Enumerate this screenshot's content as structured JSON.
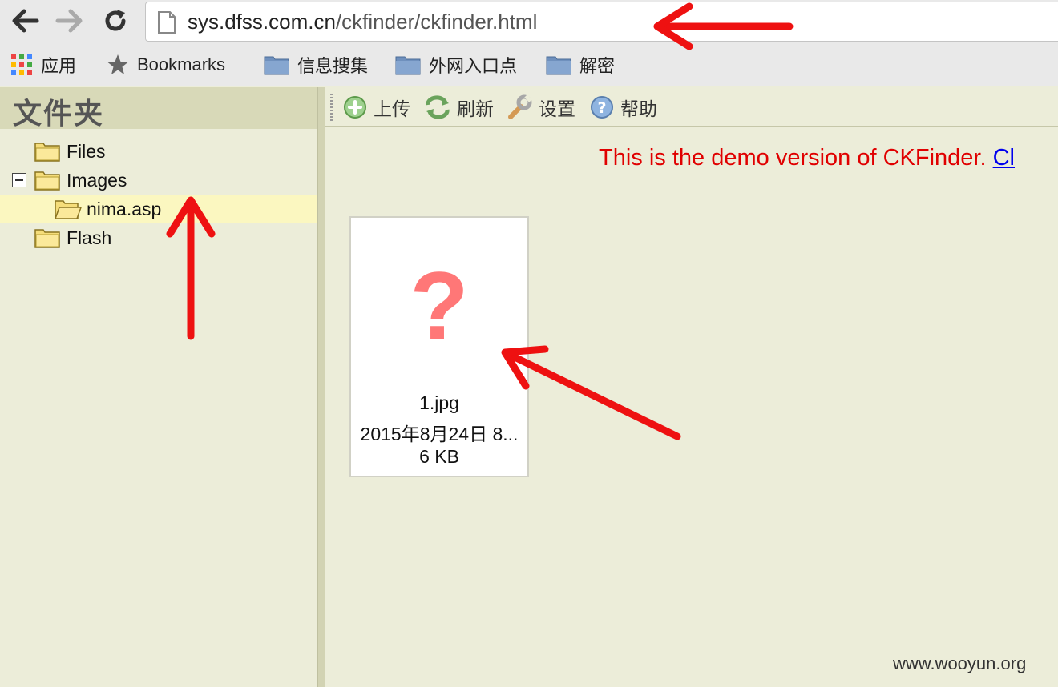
{
  "browser": {
    "url_domain": "sys.dfss.com.cn",
    "url_path": "/ckfinder/ckfinder.html",
    "back_icon": "back-arrow-icon",
    "forward_icon": "forward-arrow-icon",
    "reload_icon": "reload-icon"
  },
  "bookmarks": {
    "apps_label": "应用",
    "bookmarks_label": "Bookmarks",
    "folders": [
      "信息搜集",
      "外网入口点",
      "解密"
    ]
  },
  "left_panel": {
    "title": "文件夹",
    "tree": [
      {
        "label": "Files",
        "level": 0
      },
      {
        "label": "Images",
        "level": 0
      },
      {
        "label": "nima.asp",
        "level": 1,
        "selected": true
      },
      {
        "label": "Flash",
        "level": 0
      }
    ]
  },
  "toolbar": {
    "upload_label": "上传",
    "refresh_label": "刷新",
    "settings_label": "设置",
    "help_label": "帮助"
  },
  "main": {
    "demo_notice": "This is the demo version of CKFinder. ",
    "demo_link": "Cl"
  },
  "file": {
    "name": "1.jpg",
    "date": "2015年8月24日 8...",
    "size": "6 KB",
    "thumb_glyph": "?"
  },
  "watermark": "www.wooyun.org",
  "colors": {
    "panel_bg": "#ecedd9",
    "header_bg": "#d8d9b8",
    "selected_bg": "#fbf7c0",
    "demo_red": "#e00000",
    "annotation_red": "#ee1111"
  }
}
